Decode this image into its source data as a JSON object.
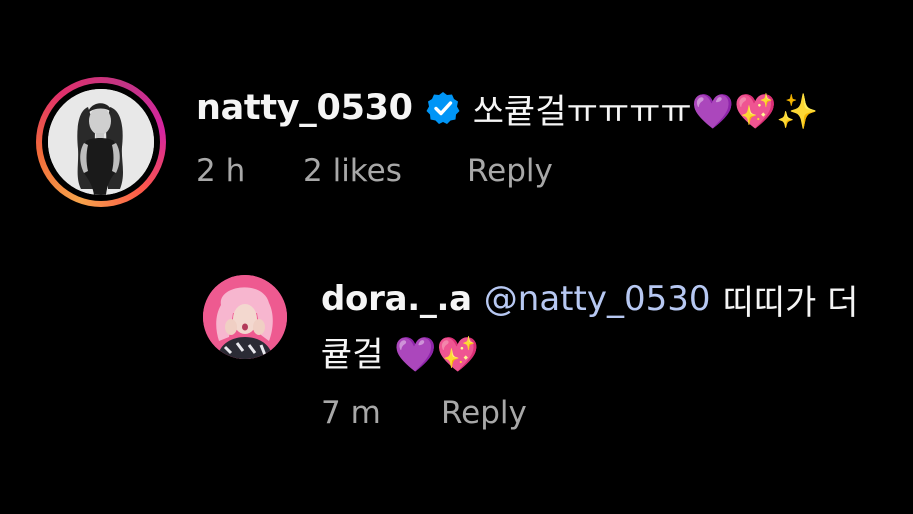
{
  "comments": [
    {
      "username": "natty_0530",
      "verified": true,
      "text": "쏘큩걸ㅠㅠㅠㅠ💜💖✨",
      "time": "2 h",
      "likes": "2 likes",
      "reply_label": "Reply",
      "ring_colors": [
        "#f7a34b",
        "#e1306c",
        "#c13584"
      ]
    }
  ],
  "replies": [
    {
      "username": "dora._.a",
      "mention": "@natty_0530",
      "text_line1": "띠띠가 더",
      "text_line2": "큩걸 💜💖",
      "time": "7 m",
      "reply_label": "Reply"
    }
  ],
  "colors": {
    "background": "#000000",
    "text": "#f5f5f5",
    "muted": "#a8a8a8",
    "mention": "#b7c8f2",
    "verified": "#0095f6"
  }
}
